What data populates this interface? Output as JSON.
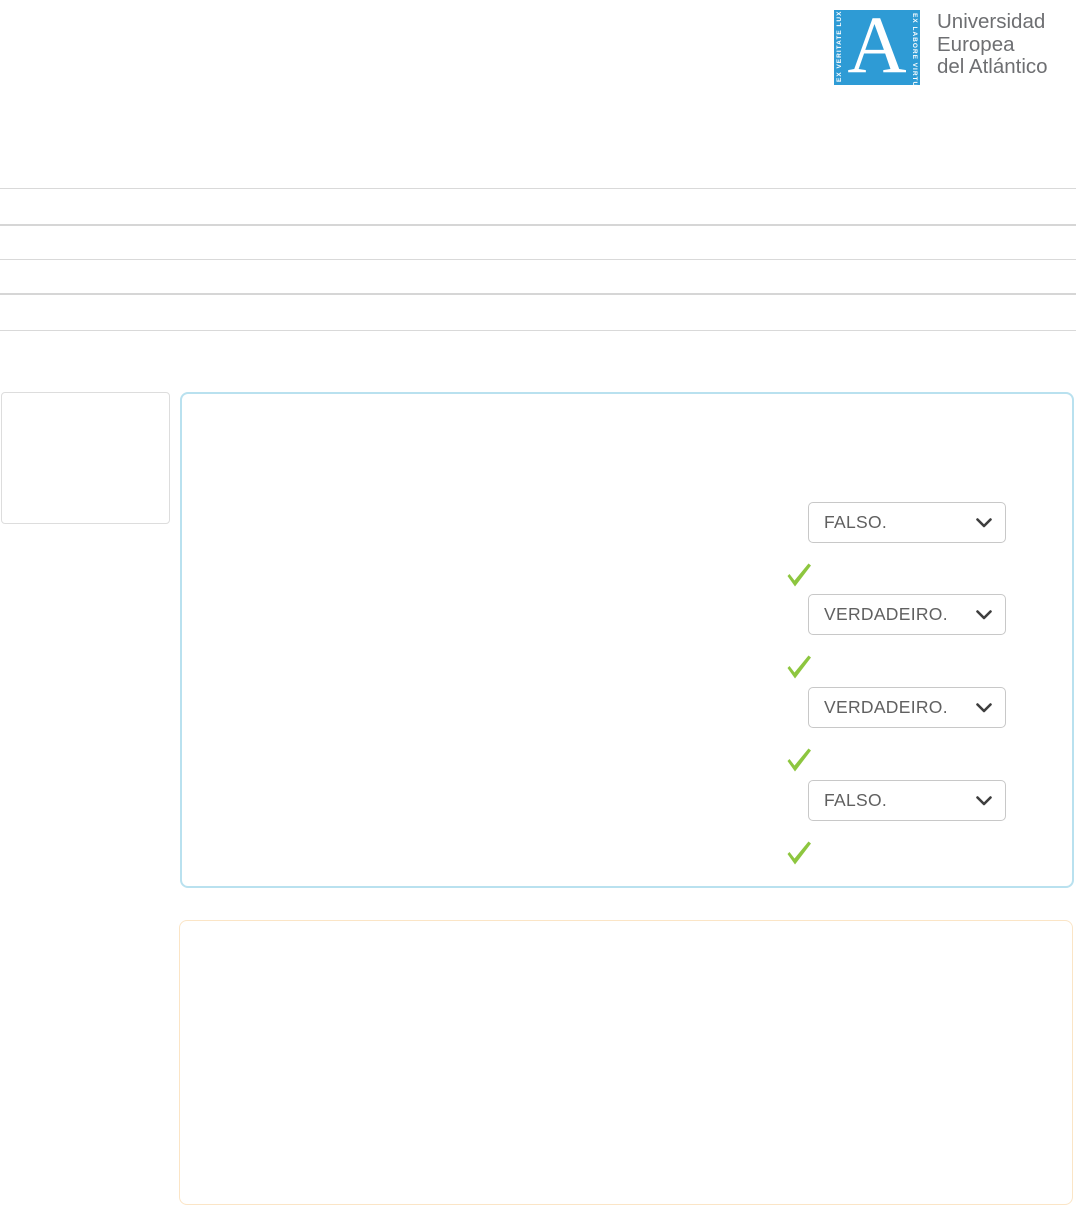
{
  "header": {
    "logo": {
      "crest_letter": "A",
      "motto_left": "EX VERITATE LUX",
      "motto_right": "EX LABORE VIRTUS",
      "name_lines": [
        "Universidad",
        "Europea",
        "del Atlántico"
      ]
    }
  },
  "question": {
    "answers": [
      {
        "label": "FALSO.",
        "correct": true
      },
      {
        "label": "VERDADEIRO.",
        "correct": true
      },
      {
        "label": "VERDADEIRO.",
        "correct": true
      },
      {
        "label": "FALSO.",
        "correct": true
      }
    ]
  },
  "icons": {
    "chevron_down": "chevron-down",
    "correct_check": "check"
  },
  "colors": {
    "crest_blue": "#2e9bd5",
    "brand_text": "#6e6f72",
    "check_green": "#8dc63f",
    "question_border": "#b9e1ef",
    "feedback_border": "#fbe5c6",
    "divider_gray": "#d9d9d9",
    "select_border": "#c8c8c8",
    "select_text": "#606060"
  }
}
